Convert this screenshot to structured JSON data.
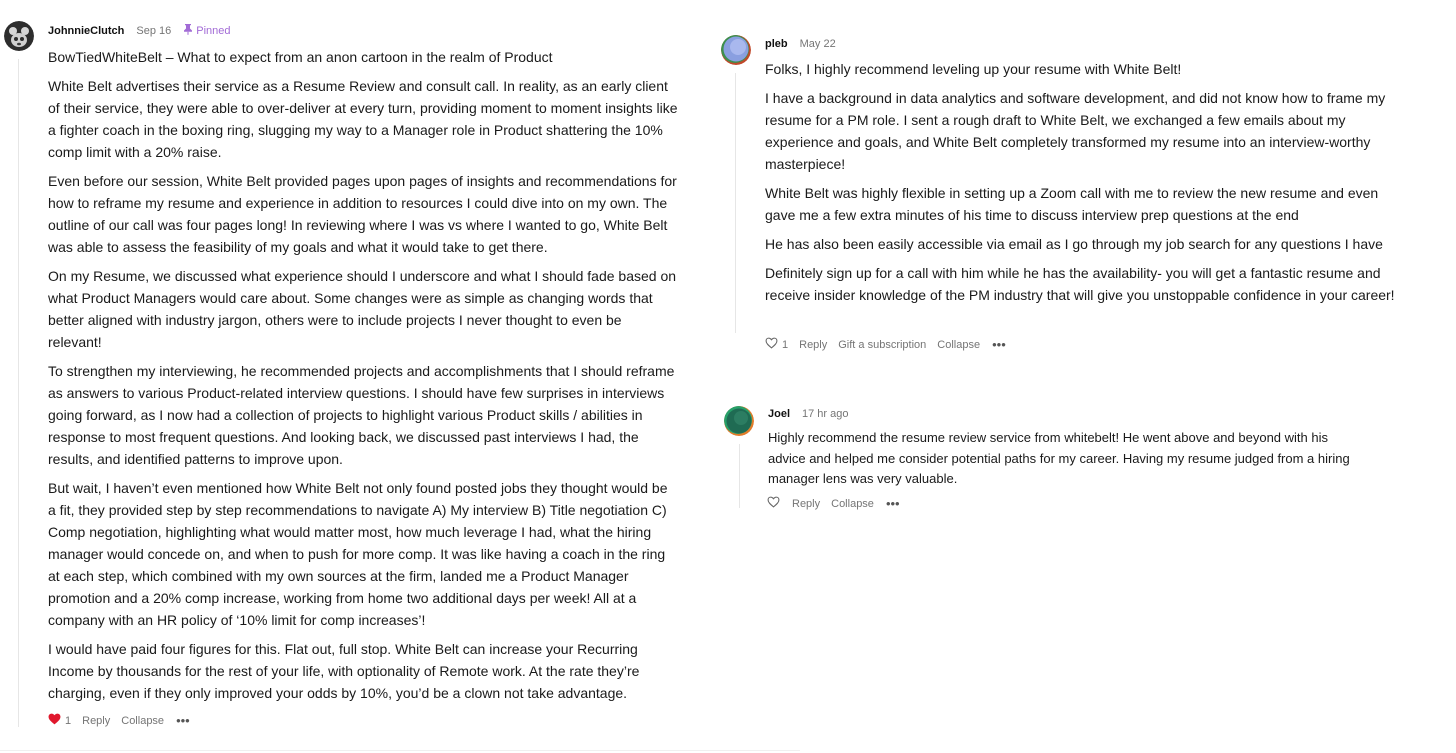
{
  "comments": [
    {
      "author": "JohnnieClutch",
      "date": "Sep 16",
      "pinned_label": "Pinned",
      "paragraphs": [
        "BowTiedWhiteBelt – What to expect from an anon cartoon in the realm of Product",
        "White Belt advertises their service as a Resume Review and consult call. In reality, as an early client of their service, they were able to over-deliver at every turn, providing moment to moment insights like a fighter coach in the boxing ring, slugging my way to a Manager role in Product shattering the 10% comp limit with a 20% raise.",
        "Even before our session, White Belt provided pages upon pages of insights and recommendations for how to reframe my resume and experience in addition to resources I could dive into on my own. The outline of our call was four pages long! In reviewing where I was vs where I wanted to go, White Belt was able to assess the feasibility of my goals and what it would take to get there.",
        "On my Resume, we discussed what experience should I underscore and what I should fade based on what Product Managers would care about. Some changes were as simple as changing words that better aligned with industry jargon, others were to include projects I never thought to even be relevant!",
        "To strengthen my interviewing, he recommended projects and accomplishments that I should reframe as answers to various Product-related interview questions. I should have few surprises in interviews going forward, as I now had a collection of projects to highlight various Product skills / abilities in response to most frequent questions. And looking back, we discussed past interviews I had, the results, and identified patterns to improve upon.",
        "But wait, I haven’t even mentioned how White Belt not only found posted jobs they thought would be a fit, they provided step by step recommendations to navigate A) My interview B) Title negotiation C) Comp negotiation, highlighting what would matter most, how much leverage I had, what the hiring manager would concede on, and when to push for more comp. It was like having a coach in the ring at each step, which combined with my own sources at the firm, landed me a Product Manager promotion and a 20% comp increase, working from home two additional days per week! All at a company with an HR policy of ‘10% limit for comp increases’!",
        "I would have paid four figures for this. Flat out, full stop. White Belt can increase your Recurring Income by thousands for the rest of your life, with optionality of Remote work. At the rate they’re charging, even if they only improved your odds by 10%, you’d be a clown not take advantage."
      ],
      "likes": "1",
      "actions": {
        "reply": "Reply",
        "collapse": "Collapse",
        "more": "•••"
      }
    },
    {
      "author": "pleb",
      "date": "May 22",
      "paragraphs": [
        "Folks, I highly recommend leveling up your resume with White Belt!",
        "I have a background in data analytics and software development, and did not know how to frame my resume for a PM role. I sent a rough draft to White Belt, we exchanged a few emails about my experience and goals, and White Belt completely transformed my resume into an interview-worthy masterpiece!",
        "White Belt was highly flexible in setting up a Zoom call with me to review the new resume and even gave me a few extra minutes of his time to discuss interview prep questions at the end",
        "He has also been easily accessible via email as I go through my job search for any questions I have",
        "Definitely sign up for a call with him while he has the availability- you will get a fantastic resume and receive insider knowledge of the PM industry that will give you unstoppable confidence in your career!"
      ],
      "likes": "1",
      "actions": {
        "reply": "Reply",
        "gift": "Gift a subscription",
        "collapse": "Collapse",
        "more": "•••"
      }
    },
    {
      "author": "Joel",
      "date": "17 hr ago",
      "paragraphs": [
        "Highly recommend the resume review service from whitebelt! He went above and beyond with his advice and helped me consider potential paths for my career. Having my resume judged from a hiring manager lens was very valuable."
      ],
      "actions": {
        "reply": "Reply",
        "collapse": "Collapse",
        "more": "•••"
      }
    }
  ],
  "colors": {
    "heart_liked": "#e0182d",
    "pinned_accent": "#a26bd6",
    "meta_text": "#757575"
  },
  "icons": {
    "pinned": "pin-icon",
    "liked": "heart-filled-icon",
    "not_liked": "heart-outline-icon",
    "more": "more-dots-icon"
  }
}
